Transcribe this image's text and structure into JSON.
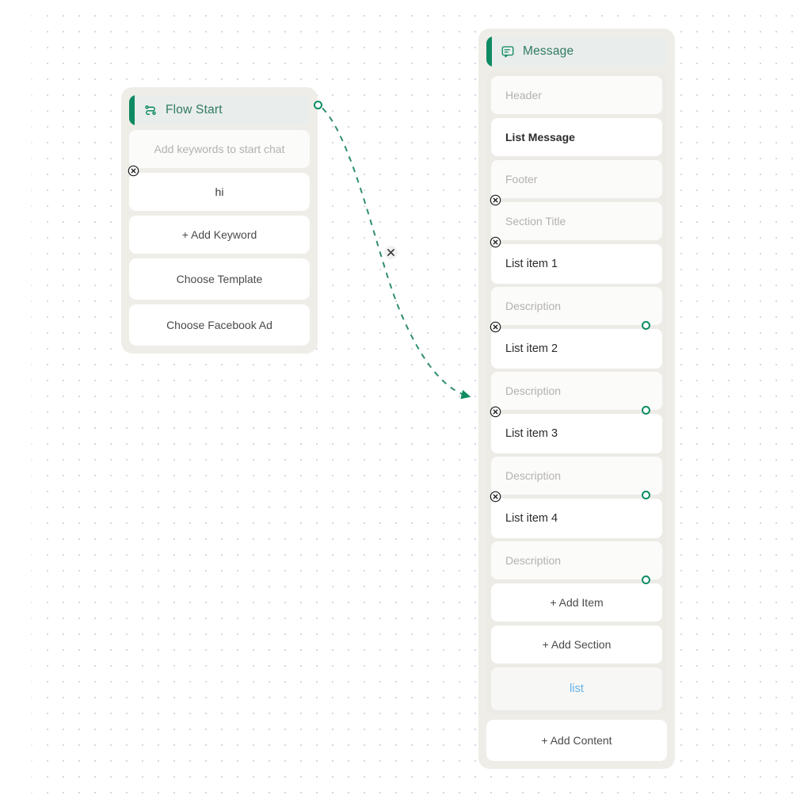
{
  "canvas": {
    "background_color": "#ffffff",
    "dot_color": "#d9d5e4",
    "accent_color": "#0e8a62",
    "link_color": "#63b2e8"
  },
  "nodes": {
    "flow_start": {
      "title": "Flow Start",
      "icon": "flow-route-icon",
      "fields": [
        {
          "name": "keywords-placeholder",
          "text": "Add keywords to start chat",
          "style": "muted"
        },
        {
          "name": "keyword-hi",
          "text": "hi",
          "style": "value",
          "removable": true
        },
        {
          "name": "add-keyword",
          "text": "+ Add Keyword",
          "style": "action"
        },
        {
          "name": "choose-template",
          "text": "Choose Template",
          "style": "action"
        },
        {
          "name": "choose-facebook-ad",
          "text": "Choose Facebook Ad",
          "style": "action"
        }
      ]
    },
    "message": {
      "title": "Message",
      "icon": "chat-bubble-icon",
      "header_field": "Header",
      "body_field": "List Message",
      "footer_field": "Footer",
      "section_title": "Section Title",
      "items": [
        {
          "title": "List item 1",
          "description": "Description"
        },
        {
          "title": "List item 2",
          "description": "Description"
        },
        {
          "title": "List item 3",
          "description": "Description"
        },
        {
          "title": "List item 4",
          "description": "Description"
        }
      ],
      "add_item": "+ Add Item",
      "add_section": "+ Add Section",
      "list_link": "list",
      "add_content": "+ Add Content"
    }
  },
  "edge": {
    "from": "flow-start-output",
    "to": "message-input",
    "style": "dashed",
    "color": "#2f8f6e",
    "delete_icon": "close-icon"
  }
}
